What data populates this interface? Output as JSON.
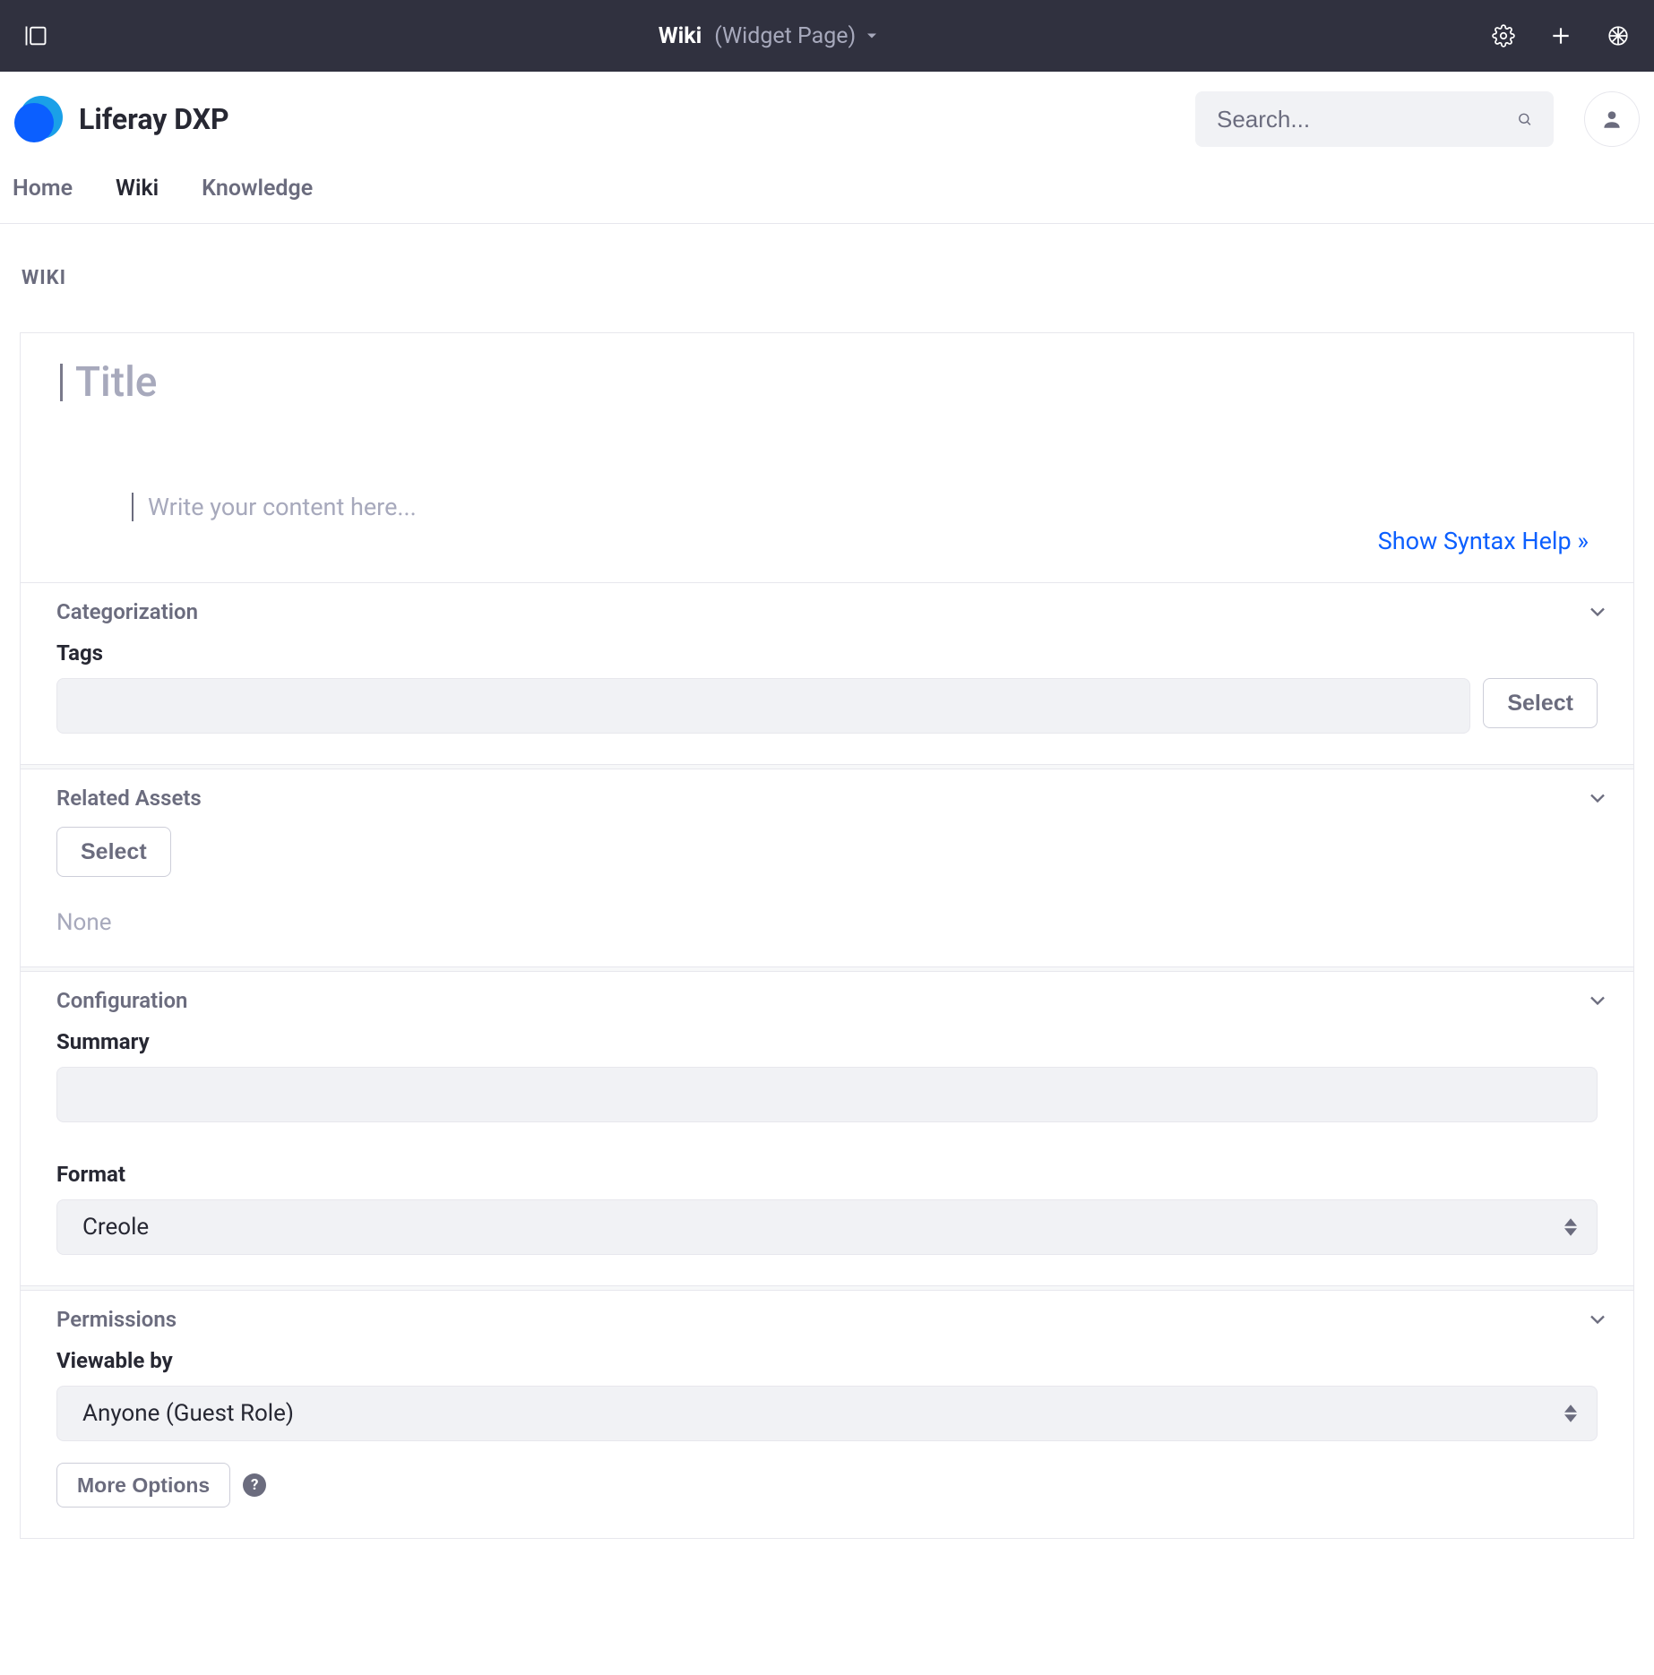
{
  "topbar": {
    "title_bold": "Wiki",
    "title_muted": "(Widget Page)"
  },
  "site": {
    "name": "Liferay DXP",
    "search_placeholder": "Search..."
  },
  "nav": {
    "items": [
      {
        "label": "Home",
        "active": false
      },
      {
        "label": "Wiki",
        "active": true
      },
      {
        "label": "Knowledge",
        "active": false
      }
    ]
  },
  "breadcrumb": "WIKI",
  "editor": {
    "title_placeholder": "Title",
    "content_placeholder": "Write your content here...",
    "syntax_help": "Show Syntax Help »"
  },
  "sections": {
    "categorization": {
      "title": "Categorization",
      "tags_label": "Tags",
      "select_label": "Select"
    },
    "related_assets": {
      "title": "Related Assets",
      "select_label": "Select",
      "none_label": "None"
    },
    "configuration": {
      "title": "Configuration",
      "summary_label": "Summary",
      "format_label": "Format",
      "format_value": "Creole"
    },
    "permissions": {
      "title": "Permissions",
      "viewable_label": "Viewable by",
      "viewable_value": "Anyone (Guest Role)",
      "more_options_label": "More Options",
      "help_glyph": "?"
    }
  }
}
